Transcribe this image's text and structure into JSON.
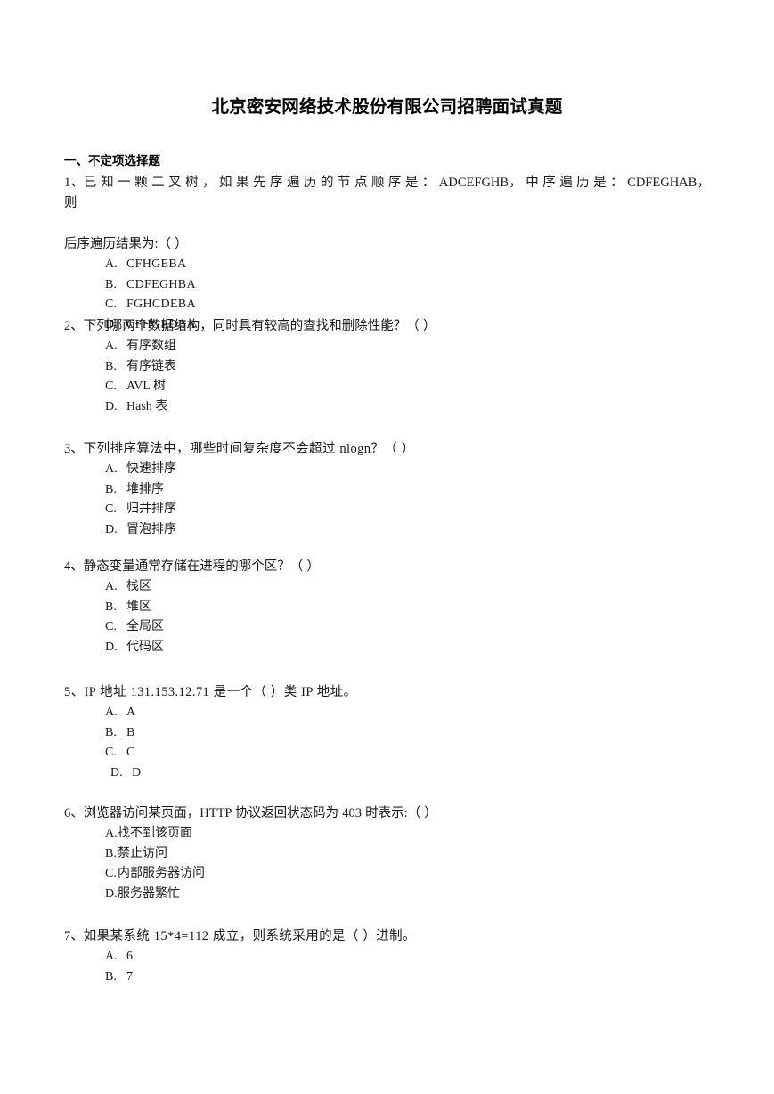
{
  "document": {
    "title": "北京密安网络技术股份有限公司招聘面试真题",
    "section_heading": "一、不定项选择题"
  },
  "questions": [
    {
      "number": "1、",
      "line1": "已 知 一 颗 二 叉 树 ， 如 果 先 序 遍 历 的 节 点 顺 序 是 ： ADCEFGHB， 中 序 遍 历 是 ： CDFEGHAB， 则",
      "line2": "后序遍历结果为:（     ）",
      "options": [
        {
          "letter": "A.",
          "text": "CFHGEBA"
        },
        {
          "letter": "B.",
          "text": "CDFEGHBA"
        },
        {
          "letter": "C.",
          "text": "FGHCDEBA"
        },
        {
          "letter": "D.",
          "text": "CFHGEDBA"
        }
      ]
    },
    {
      "number": "2、",
      "line1": "下列哪两个数据结构，同时具有较高的查找和删除性能？（      ）",
      "options": [
        {
          "letter": "A.",
          "text": "有序数组"
        },
        {
          "letter": "B.",
          "text": "有序链表"
        },
        {
          "letter": "C.",
          "text": "AVL 树"
        },
        {
          "letter": "D.",
          "text": "Hash 表"
        }
      ]
    },
    {
      "number": "3、",
      "line1": "下列排序算法中，哪些时间复杂度不会超过 nlogn？（      ）",
      "options": [
        {
          "letter": "A.",
          "text": "快速排序"
        },
        {
          "letter": "B.",
          "text": "堆排序"
        },
        {
          "letter": "C.",
          "text": "归并排序"
        },
        {
          "letter": "D.",
          "text": "冒泡排序"
        }
      ]
    },
    {
      "number": "4、",
      "line1": "静态变量通常存储在进程的哪个区？（      ）",
      "options": [
        {
          "letter": "A.",
          "text": "栈区"
        },
        {
          "letter": "B.",
          "text": "堆区"
        },
        {
          "letter": "C.",
          "text": "全局区"
        },
        {
          "letter": "D.",
          "text": "代码区"
        }
      ]
    },
    {
      "number": "5、",
      "line1": "IP 地址 131.153.12.71 是一个（      ）类 IP 地址。",
      "options": [
        {
          "letter": "A.",
          "text": "A"
        },
        {
          "letter": "B.",
          "text": "B"
        },
        {
          "letter": "C.",
          "text": "C"
        },
        {
          "letter": "D.",
          "text": "D"
        }
      ]
    },
    {
      "number": "6、",
      "line1": "浏览器访问某页面，HTTP 协议返回状态码为 403 时表示:（      ）",
      "options": [
        {
          "letter": "A.",
          "text": "找不到该页面"
        },
        {
          "letter": "B.",
          "text": "禁止访问"
        },
        {
          "letter": "C.",
          "text": "内部服务器访问"
        },
        {
          "letter": "D.",
          "text": "服务器繁忙"
        }
      ]
    },
    {
      "number": "7、",
      "line1": "如果某系统 15*4=112 成立，则系统采用的是（     ）进制。",
      "options": [
        {
          "letter": "A.",
          "text": "6"
        },
        {
          "letter": "B.",
          "text": "7"
        }
      ]
    }
  ]
}
